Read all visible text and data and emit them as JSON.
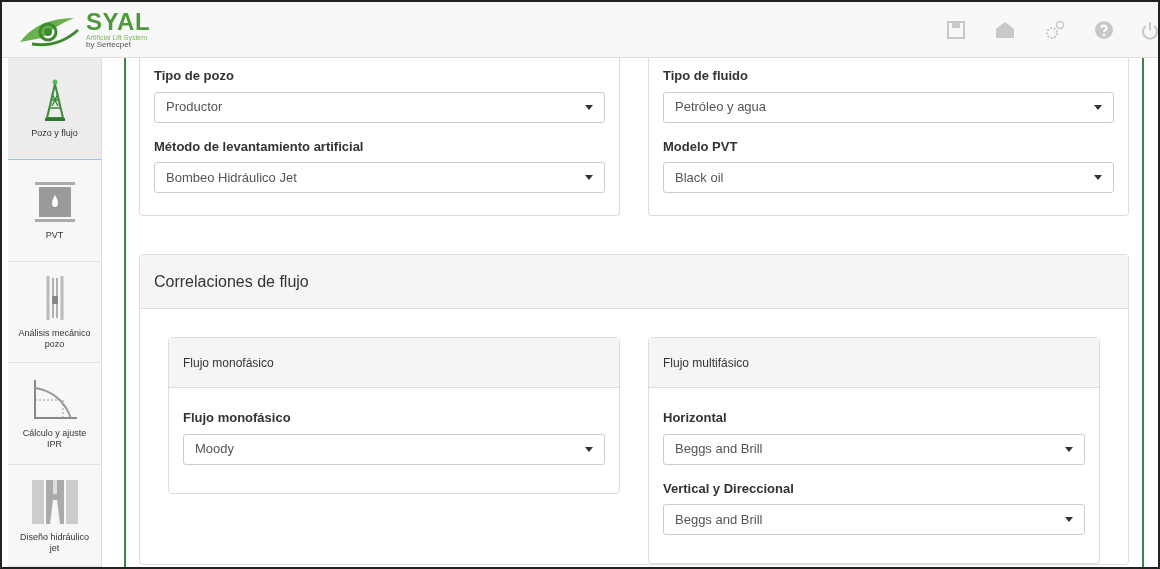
{
  "logo": {
    "name": "SYAL",
    "tagline": "Artificial Lift System",
    "byline": "by Sertecpet"
  },
  "toolbar": [
    {
      "kind": "save"
    },
    {
      "kind": "home"
    },
    {
      "kind": "gears"
    },
    {
      "kind": "help"
    },
    {
      "kind": "power"
    }
  ],
  "sidebar": {
    "items": [
      {
        "label": "Pozo y flujo",
        "kind": "well",
        "selected": true
      },
      {
        "label": "PVT",
        "kind": "pvt",
        "selected": false
      },
      {
        "label": "Análisis mecánico pozo",
        "kind": "mech",
        "selected": false
      },
      {
        "label": "Cálculo y ajuste IPR",
        "kind": "ipr",
        "selected": false
      },
      {
        "label": "Diseño hidráulico jet",
        "kind": "jet",
        "selected": false
      }
    ]
  },
  "top_cards": [
    {
      "fields": [
        {
          "label": "Tipo de pozo",
          "value": "Productor"
        },
        {
          "label": "Método de levantamiento artificial",
          "value": "Bombeo Hidráulico Jet"
        }
      ]
    },
    {
      "fields": [
        {
          "label": "Tipo de fluido",
          "value": "Petróleo y agua"
        },
        {
          "label": "Modelo PVT",
          "value": "Black oil"
        }
      ]
    }
  ],
  "correlations": {
    "title": "Correlaciones de flujo",
    "panels": [
      {
        "title": "Flujo monofásico",
        "fields": [
          {
            "label": "Flujo monofásico",
            "value": "Moody"
          }
        ]
      },
      {
        "title": "Flujo multifásico",
        "fields": [
          {
            "label": "Horizontal",
            "value": "Beggs and Brill"
          },
          {
            "label": "Vertical y Direccional",
            "value": "Beggs and Brill"
          }
        ]
      }
    ]
  }
}
